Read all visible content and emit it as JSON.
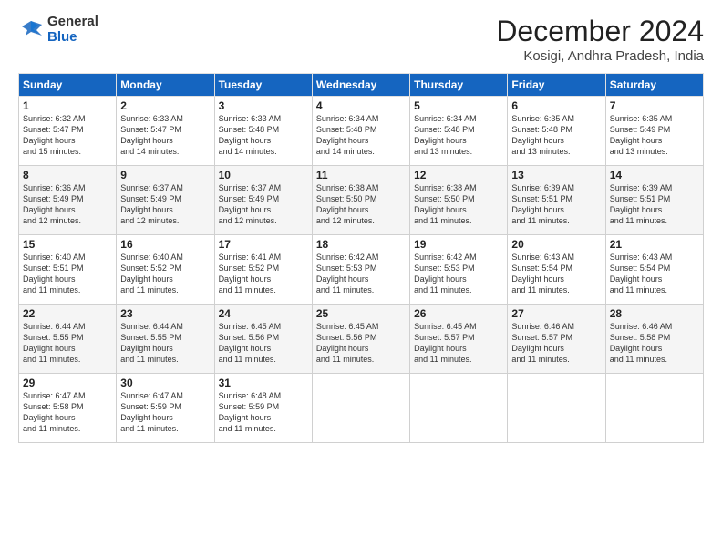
{
  "logo": {
    "general": "General",
    "blue": "Blue"
  },
  "title": "December 2024",
  "location": "Kosigi, Andhra Pradesh, India",
  "days_header": [
    "Sunday",
    "Monday",
    "Tuesday",
    "Wednesday",
    "Thursday",
    "Friday",
    "Saturday"
  ],
  "weeks": [
    [
      {
        "day": "1",
        "sunrise": "6:32 AM",
        "sunset": "5:47 PM",
        "daylight": "11 hours and 15 minutes."
      },
      {
        "day": "2",
        "sunrise": "6:33 AM",
        "sunset": "5:47 PM",
        "daylight": "11 hours and 14 minutes."
      },
      {
        "day": "3",
        "sunrise": "6:33 AM",
        "sunset": "5:48 PM",
        "daylight": "11 hours and 14 minutes."
      },
      {
        "day": "4",
        "sunrise": "6:34 AM",
        "sunset": "5:48 PM",
        "daylight": "11 hours and 14 minutes."
      },
      {
        "day": "5",
        "sunrise": "6:34 AM",
        "sunset": "5:48 PM",
        "daylight": "11 hours and 13 minutes."
      },
      {
        "day": "6",
        "sunrise": "6:35 AM",
        "sunset": "5:48 PM",
        "daylight": "11 hours and 13 minutes."
      },
      {
        "day": "7",
        "sunrise": "6:35 AM",
        "sunset": "5:49 PM",
        "daylight": "11 hours and 13 minutes."
      }
    ],
    [
      {
        "day": "8",
        "sunrise": "6:36 AM",
        "sunset": "5:49 PM",
        "daylight": "11 hours and 12 minutes."
      },
      {
        "day": "9",
        "sunrise": "6:37 AM",
        "sunset": "5:49 PM",
        "daylight": "11 hours and 12 minutes."
      },
      {
        "day": "10",
        "sunrise": "6:37 AM",
        "sunset": "5:49 PM",
        "daylight": "11 hours and 12 minutes."
      },
      {
        "day": "11",
        "sunrise": "6:38 AM",
        "sunset": "5:50 PM",
        "daylight": "11 hours and 12 minutes."
      },
      {
        "day": "12",
        "sunrise": "6:38 AM",
        "sunset": "5:50 PM",
        "daylight": "11 hours and 11 minutes."
      },
      {
        "day": "13",
        "sunrise": "6:39 AM",
        "sunset": "5:51 PM",
        "daylight": "11 hours and 11 minutes."
      },
      {
        "day": "14",
        "sunrise": "6:39 AM",
        "sunset": "5:51 PM",
        "daylight": "11 hours and 11 minutes."
      }
    ],
    [
      {
        "day": "15",
        "sunrise": "6:40 AM",
        "sunset": "5:51 PM",
        "daylight": "11 hours and 11 minutes."
      },
      {
        "day": "16",
        "sunrise": "6:40 AM",
        "sunset": "5:52 PM",
        "daylight": "11 hours and 11 minutes."
      },
      {
        "day": "17",
        "sunrise": "6:41 AM",
        "sunset": "5:52 PM",
        "daylight": "11 hours and 11 minutes."
      },
      {
        "day": "18",
        "sunrise": "6:42 AM",
        "sunset": "5:53 PM",
        "daylight": "11 hours and 11 minutes."
      },
      {
        "day": "19",
        "sunrise": "6:42 AM",
        "sunset": "5:53 PM",
        "daylight": "11 hours and 11 minutes."
      },
      {
        "day": "20",
        "sunrise": "6:43 AM",
        "sunset": "5:54 PM",
        "daylight": "11 hours and 11 minutes."
      },
      {
        "day": "21",
        "sunrise": "6:43 AM",
        "sunset": "5:54 PM",
        "daylight": "11 hours and 11 minutes."
      }
    ],
    [
      {
        "day": "22",
        "sunrise": "6:44 AM",
        "sunset": "5:55 PM",
        "daylight": "11 hours and 11 minutes."
      },
      {
        "day": "23",
        "sunrise": "6:44 AM",
        "sunset": "5:55 PM",
        "daylight": "11 hours and 11 minutes."
      },
      {
        "day": "24",
        "sunrise": "6:45 AM",
        "sunset": "5:56 PM",
        "daylight": "11 hours and 11 minutes."
      },
      {
        "day": "25",
        "sunrise": "6:45 AM",
        "sunset": "5:56 PM",
        "daylight": "11 hours and 11 minutes."
      },
      {
        "day": "26",
        "sunrise": "6:45 AM",
        "sunset": "5:57 PM",
        "daylight": "11 hours and 11 minutes."
      },
      {
        "day": "27",
        "sunrise": "6:46 AM",
        "sunset": "5:57 PM",
        "daylight": "11 hours and 11 minutes."
      },
      {
        "day": "28",
        "sunrise": "6:46 AM",
        "sunset": "5:58 PM",
        "daylight": "11 hours and 11 minutes."
      }
    ],
    [
      {
        "day": "29",
        "sunrise": "6:47 AM",
        "sunset": "5:58 PM",
        "daylight": "11 hours and 11 minutes."
      },
      {
        "day": "30",
        "sunrise": "6:47 AM",
        "sunset": "5:59 PM",
        "daylight": "11 hours and 11 minutes."
      },
      {
        "day": "31",
        "sunrise": "6:48 AM",
        "sunset": "5:59 PM",
        "daylight": "11 hours and 11 minutes."
      },
      null,
      null,
      null,
      null
    ]
  ]
}
